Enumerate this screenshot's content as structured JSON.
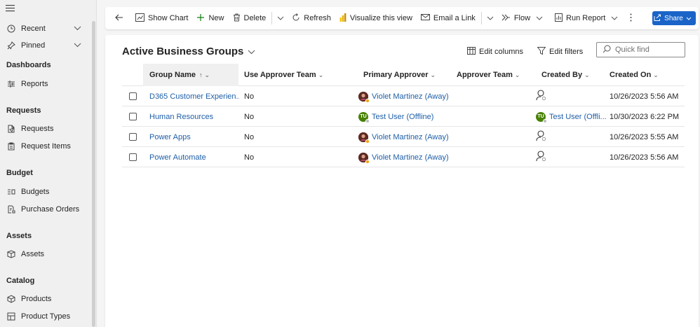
{
  "sidebar": {
    "menu_icon": "hamburger-icon",
    "items": [
      {
        "label": "Recent",
        "icon": "clock-icon",
        "expandable": true
      },
      {
        "label": "Pinned",
        "icon": "pin-icon",
        "expandable": true
      }
    ],
    "groups": [
      {
        "heading": "Dashboards",
        "items": [
          {
            "label": "Reports",
            "icon": "reports-icon"
          }
        ]
      },
      {
        "heading": "Requests",
        "items": [
          {
            "label": "Requests",
            "icon": "request-icon"
          },
          {
            "label": "Request Items",
            "icon": "request-items-icon"
          }
        ]
      },
      {
        "heading": "Budget",
        "items": [
          {
            "label": "Budgets",
            "icon": "budget-icon"
          },
          {
            "label": "Purchase Orders",
            "icon": "purchase-order-icon"
          }
        ]
      },
      {
        "heading": "Assets",
        "items": [
          {
            "label": "Assets",
            "icon": "asset-icon"
          }
        ]
      },
      {
        "heading": "Catalog",
        "items": [
          {
            "label": "Products",
            "icon": "product-icon"
          },
          {
            "label": "Product Types",
            "icon": "product-types-icon"
          }
        ]
      }
    ]
  },
  "toolbar": {
    "back": "back-arrow-icon",
    "show_chart": "Show Chart",
    "new": "New",
    "delete": "Delete",
    "refresh": "Refresh",
    "visualize": "Visualize this view",
    "email_link": "Email a Link",
    "flow": "Flow",
    "run_report": "Run Report",
    "more": "more-icon",
    "share": "Share"
  },
  "view": {
    "title": "Active Business Groups",
    "edit_columns": "Edit columns",
    "edit_filters": "Edit filters",
    "quick_find_placeholder": "Quick find"
  },
  "grid": {
    "columns": [
      "Group Name",
      "Use Approver Team",
      "Primary Approver",
      "Approver Team",
      "Created By",
      "Created On"
    ],
    "sort_indicator": "↑",
    "rows": [
      {
        "group_name": "D365 Customer Experien...",
        "use_approver_team": "No",
        "primary_approver": "Violet Martinez (Away)",
        "approver_avatar": "photo",
        "approver_status": "#f4a000",
        "approver_team": "",
        "created_by": "",
        "created_by_type": "unknown",
        "created_on": "10/26/2023 5:56 AM"
      },
      {
        "group_name": "Human Resources",
        "use_approver_team": "No",
        "primary_approver": "Test User (Offline)",
        "approver_avatar": "TU",
        "approver_status": "#bdbdbd",
        "approver_team": "",
        "created_by": "Test User (Offli...",
        "created_by_type": "user",
        "created_on": "10/30/2023 6:22 PM"
      },
      {
        "group_name": "Power Apps",
        "use_approver_team": "No",
        "primary_approver": "Violet Martinez (Away)",
        "approver_avatar": "photo",
        "approver_status": "#f4a000",
        "approver_team": "",
        "created_by": "",
        "created_by_type": "unknown",
        "created_on": "10/26/2023 5:55 AM"
      },
      {
        "group_name": "Power Automate",
        "use_approver_team": "No",
        "primary_approver": "Violet Martinez (Away)",
        "approver_avatar": "photo",
        "approver_status": "#f4a000",
        "approver_team": "",
        "created_by": "",
        "created_by_type": "unknown",
        "created_on": "10/26/2023 5:56 AM"
      }
    ]
  },
  "colors": {
    "accent": "#1a64c8",
    "link": "#1f5fa8",
    "avatar_initials_bg": "#498205"
  }
}
